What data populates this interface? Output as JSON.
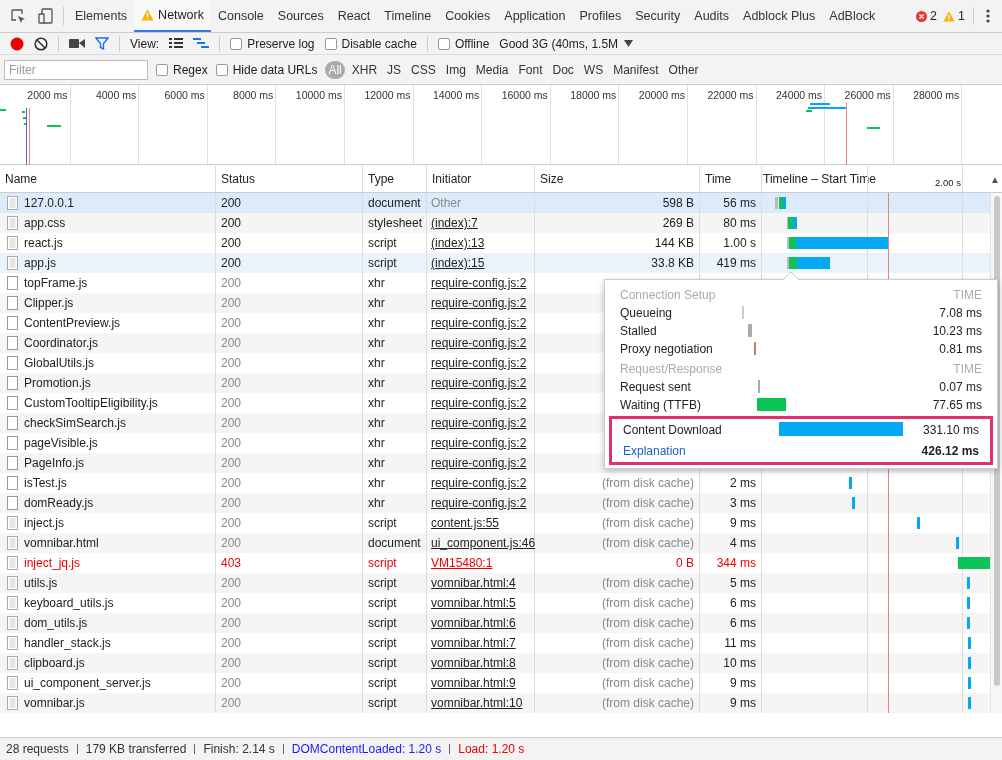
{
  "tabs": [
    {
      "label": "Elements",
      "selected": false,
      "warning": false
    },
    {
      "label": "Network",
      "selected": true,
      "warning": true
    },
    {
      "label": "Console",
      "selected": false,
      "warning": false
    },
    {
      "label": "Sources",
      "selected": false,
      "warning": false
    },
    {
      "label": "React",
      "selected": false,
      "warning": false
    },
    {
      "label": "Timeline",
      "selected": false,
      "warning": false
    },
    {
      "label": "Cookies",
      "selected": false,
      "warning": false
    },
    {
      "label": "Application",
      "selected": false,
      "warning": false
    },
    {
      "label": "Profiles",
      "selected": false,
      "warning": false
    },
    {
      "label": "Security",
      "selected": false,
      "warning": false
    },
    {
      "label": "Audits",
      "selected": false,
      "warning": false
    },
    {
      "label": "Adblock Plus",
      "selected": false,
      "warning": false
    },
    {
      "label": "AdBlock",
      "selected": false,
      "warning": false
    }
  ],
  "counters": {
    "errors": "2",
    "warnings": "1"
  },
  "toolbar": {
    "recording": true,
    "filter_on": true,
    "view_label": "View:",
    "large_rows": false,
    "overview": true,
    "checkboxes": [
      {
        "label": "Preserve log",
        "checked": false
      },
      {
        "label": "Disable cache",
        "checked": false
      }
    ],
    "offline": {
      "label": "Offline",
      "checked": false
    },
    "throttling": "Good 3G (40ms, 1.5M"
  },
  "filter_bar": {
    "placeholder": "Filter",
    "checkboxes": [
      {
        "label": "Regex",
        "checked": false
      },
      {
        "label": "Hide data URLs",
        "checked": false
      }
    ],
    "types": [
      {
        "label": "All",
        "selected": true
      },
      {
        "label": "XHR",
        "selected": false
      },
      {
        "label": "JS",
        "selected": false
      },
      {
        "label": "CSS",
        "selected": false
      },
      {
        "label": "Img",
        "selected": false
      },
      {
        "label": "Media",
        "selected": false
      },
      {
        "label": "Font",
        "selected": false
      },
      {
        "label": "Doc",
        "selected": false
      },
      {
        "label": "WS",
        "selected": false
      },
      {
        "label": "Manifest",
        "selected": false
      },
      {
        "label": "Other",
        "selected": false
      }
    ]
  },
  "overview_ticks": [
    "2000 ms",
    "4000 ms",
    "6000 ms",
    "8000 ms",
    "10000 ms",
    "12000 ms",
    "14000 ms",
    "16000 ms",
    "18000 ms",
    "20000 ms",
    "22000 ms",
    "24000 ms",
    "26000 ms",
    "28000 ms"
  ],
  "table": {
    "columns": [
      "Name",
      "Status",
      "Type",
      "Initiator",
      "Size",
      "Time",
      "Timeline – Start Time"
    ],
    "timeline_scale": "2.00 s",
    "sort_indicator": "▲",
    "rows": [
      {
        "name": "127.0.0.1",
        "status": "200",
        "type": "document",
        "initiator": "Other",
        "initiator_linked": false,
        "size": "598 B",
        "time": "56 ms",
        "kind": "lined",
        "cached": false,
        "error": false,
        "selected": true,
        "hovered": false
      },
      {
        "name": "app.css",
        "status": "200",
        "type": "stylesheet",
        "initiator": "(index):7",
        "initiator_linked": true,
        "size": "269 B",
        "time": "80 ms",
        "kind": "lined",
        "cached": false,
        "error": false,
        "selected": false,
        "hovered": false
      },
      {
        "name": "react.js",
        "status": "200",
        "type": "script",
        "initiator": "(index):13",
        "initiator_linked": true,
        "size": "144 KB",
        "time": "1.00 s",
        "kind": "lined",
        "cached": false,
        "error": false,
        "selected": false,
        "hovered": false
      },
      {
        "name": "app.js",
        "status": "200",
        "type": "script",
        "initiator": "(index):15",
        "initiator_linked": true,
        "size": "33.8 KB",
        "time": "419 ms",
        "kind": "lined",
        "cached": false,
        "error": false,
        "selected": false,
        "hovered": true
      },
      {
        "name": "topFrame.js",
        "status": "200",
        "type": "xhr",
        "initiator": "require-config.js:2",
        "initiator_linked": true,
        "kind": "blank",
        "cached": true,
        "error": false,
        "selected": false,
        "hovered": false
      },
      {
        "name": "Clipper.js",
        "status": "200",
        "type": "xhr",
        "initiator": "require-config.js:2",
        "initiator_linked": true,
        "kind": "blank",
        "cached": true,
        "error": false,
        "selected": false,
        "hovered": false
      },
      {
        "name": "ContentPreview.js",
        "status": "200",
        "type": "xhr",
        "initiator": "require-config.js:2",
        "initiator_linked": true,
        "kind": "blank",
        "cached": true,
        "error": false,
        "selected": false,
        "hovered": false
      },
      {
        "name": "Coordinator.js",
        "status": "200",
        "type": "xhr",
        "initiator": "require-config.js:2",
        "initiator_linked": true,
        "kind": "blank",
        "cached": true,
        "error": false,
        "selected": false,
        "hovered": false
      },
      {
        "name": "GlobalUtils.js",
        "status": "200",
        "type": "xhr",
        "initiator": "require-config.js:2",
        "initiator_linked": true,
        "kind": "blank",
        "cached": true,
        "error": false,
        "selected": false,
        "hovered": false
      },
      {
        "name": "Promotion.js",
        "status": "200",
        "type": "xhr",
        "initiator": "require-config.js:2",
        "initiator_linked": true,
        "kind": "blank",
        "cached": true,
        "error": false,
        "selected": false,
        "hovered": false
      },
      {
        "name": "CustomTooltipEligibility.js",
        "status": "200",
        "type": "xhr",
        "initiator": "require-config.js:2",
        "initiator_linked": true,
        "kind": "blank",
        "cached": true,
        "error": false,
        "selected": false,
        "hovered": false
      },
      {
        "name": "checkSimSearch.js",
        "status": "200",
        "type": "xhr",
        "initiator": "require-config.js:2",
        "initiator_linked": true,
        "kind": "blank",
        "cached": true,
        "error": false,
        "selected": false,
        "hovered": false
      },
      {
        "name": "pageVisible.js",
        "status": "200",
        "type": "xhr",
        "initiator": "require-config.js:2",
        "initiator_linked": true,
        "kind": "blank",
        "cached": true,
        "error": false,
        "selected": false,
        "hovered": false
      },
      {
        "name": "PageInfo.js",
        "status": "200",
        "type": "xhr",
        "initiator": "require-config.js:2",
        "initiator_linked": true,
        "kind": "blank",
        "cached": true,
        "error": false,
        "selected": false,
        "hovered": false
      },
      {
        "name": "isTest.js",
        "status": "200",
        "type": "xhr",
        "initiator": "require-config.js:2",
        "initiator_linked": true,
        "size": "(from disk cache)",
        "time": "2 ms",
        "kind": "blank",
        "cached": true,
        "error": false,
        "selected": false,
        "hovered": false
      },
      {
        "name": "domReady.js",
        "status": "200",
        "type": "xhr",
        "initiator": "require-config.js:2",
        "initiator_linked": true,
        "size": "(from disk cache)",
        "time": "3 ms",
        "kind": "blank",
        "cached": true,
        "error": false,
        "selected": false,
        "hovered": false
      },
      {
        "name": "inject.js",
        "status": "200",
        "type": "script",
        "initiator": "content.js:55",
        "initiator_linked": true,
        "size": "(from disk cache)",
        "time": "9 ms",
        "kind": "lined",
        "cached": true,
        "error": false,
        "selected": false,
        "hovered": false
      },
      {
        "name": "vomnibar.html",
        "status": "200",
        "type": "document",
        "initiator": "ui_component.js:46",
        "initiator_linked": true,
        "size": "(from disk cache)",
        "time": "4 ms",
        "kind": "lined",
        "cached": true,
        "error": false,
        "selected": false,
        "hovered": false
      },
      {
        "name": "inject_jq.js",
        "status": "403",
        "type": "script",
        "initiator": "VM15480:1",
        "initiator_linked": true,
        "size": "0 B",
        "time": "344 ms",
        "kind": "lined",
        "cached": false,
        "error": true,
        "selected": false,
        "hovered": false
      },
      {
        "name": "utils.js",
        "status": "200",
        "type": "script",
        "initiator": "vomnibar.html:4",
        "initiator_linked": true,
        "size": "(from disk cache)",
        "time": "5 ms",
        "kind": "lined",
        "cached": true,
        "error": false,
        "selected": false,
        "hovered": false
      },
      {
        "name": "keyboard_utils.js",
        "status": "200",
        "type": "script",
        "initiator": "vomnibar.html:5",
        "initiator_linked": true,
        "size": "(from disk cache)",
        "time": "6 ms",
        "kind": "lined",
        "cached": true,
        "error": false,
        "selected": false,
        "hovered": false
      },
      {
        "name": "dom_utils.js",
        "status": "200",
        "type": "script",
        "initiator": "vomnibar.html:6",
        "initiator_linked": true,
        "size": "(from disk cache)",
        "time": "6 ms",
        "kind": "lined",
        "cached": true,
        "error": false,
        "selected": false,
        "hovered": false
      },
      {
        "name": "handler_stack.js",
        "status": "200",
        "type": "script",
        "initiator": "vomnibar.html:7",
        "initiator_linked": true,
        "size": "(from disk cache)",
        "time": "11 ms",
        "kind": "lined",
        "cached": true,
        "error": false,
        "selected": false,
        "hovered": false
      },
      {
        "name": "clipboard.js",
        "status": "200",
        "type": "script",
        "initiator": "vomnibar.html:8",
        "initiator_linked": true,
        "size": "(from disk cache)",
        "time": "10 ms",
        "kind": "lined",
        "cached": true,
        "error": false,
        "selected": false,
        "hovered": false
      },
      {
        "name": "ui_component_server.js",
        "status": "200",
        "type": "script",
        "initiator": "vomnibar.html:9",
        "initiator_linked": true,
        "size": "(from disk cache)",
        "time": "9 ms",
        "kind": "lined",
        "cached": true,
        "error": false,
        "selected": false,
        "hovered": false
      },
      {
        "name": "vomnibar.js",
        "status": "200",
        "type": "script",
        "initiator": "vomnibar.html:10",
        "initiator_linked": true,
        "size": "(from disk cache)",
        "time": "9 ms",
        "kind": "lined",
        "cached": true,
        "error": false,
        "selected": false,
        "hovered": false
      }
    ]
  },
  "timing_popup": {
    "sections": [
      {
        "title": "Connection Setup",
        "time_heading": "TIME",
        "rows": [
          {
            "label": "Queueing",
            "value": "7.08 ms"
          },
          {
            "label": "Stalled",
            "value": "10.23 ms"
          },
          {
            "label": "Proxy negotiation",
            "value": "0.81 ms"
          }
        ]
      },
      {
        "title": "Request/Response",
        "time_heading": "TIME",
        "rows": [
          {
            "label": "Request sent",
            "value": "0.07 ms"
          },
          {
            "label": "Waiting (TTFB)",
            "value": "77.65 ms"
          }
        ]
      }
    ],
    "highlighted": true,
    "content_download": {
      "label": "Content Download",
      "value": "331.10 ms"
    },
    "explanation": {
      "label": "Explanation",
      "total": "426.12 ms"
    }
  },
  "status_bar": [
    {
      "text": "28 requests",
      "kind": "plain"
    },
    {
      "text": "179 KB transferred",
      "kind": "plain"
    },
    {
      "text": "Finish: 2.14 s",
      "kind": "plain"
    },
    {
      "text": "DOMContentLoaded: 1.20 s",
      "kind": "dom"
    },
    {
      "text": "Load: 1.20 s",
      "kind": "load"
    }
  ]
}
